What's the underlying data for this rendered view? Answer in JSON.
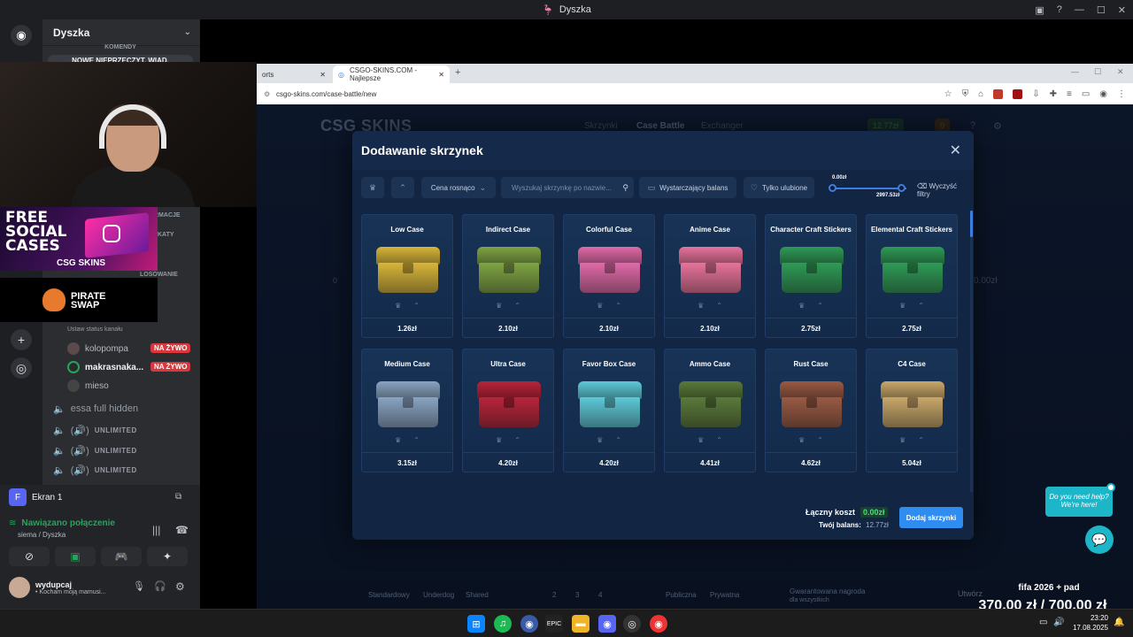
{
  "discord": {
    "window_title": "Dyszka",
    "server_name": "Dyszka",
    "notice_top": "KOMENDY",
    "notice": "NOWE NIEPRZECZYT. WIAD.",
    "side_labels": [
      "RMACJE",
      "KATY"
    ],
    "losowanie": "LOSOWANIE",
    "status_hint": "Ustaw status kanału",
    "voice_users": [
      {
        "name": "kolopompa",
        "live": "NA ŻYWO"
      },
      {
        "name": "makrasnaka...",
        "live": "NA ŻYWO"
      },
      {
        "name": "mieso",
        "live": ""
      }
    ],
    "channels": [
      {
        "name": "essa full hidden",
        "tag": ""
      },
      {
        "name": "",
        "tag": "UNLIMITED"
      },
      {
        "name": "",
        "tag": "UNLIMITED"
      },
      {
        "name": "",
        "tag": "UNLIMITED"
      }
    ],
    "screen_label": "Ekran 1",
    "connection_status": "Nawiązano połączenie",
    "connection_channel": "siema / Dyszka",
    "user_name": "wydupcaj",
    "user_status": "• Kocham moją mamusi..."
  },
  "promos": {
    "social_text": "FREE SOCIAL CASES",
    "social_brand": "CSG SKINS",
    "pirate_text": "PIRATE SWAP"
  },
  "browser": {
    "tab_prev": "orts",
    "tab_active": "CSGO-SKINS.COM - Najlepsze",
    "url": "csgo-skins.com/case-battle/new"
  },
  "site": {
    "logo": "CSG SKINS",
    "nav": [
      "Skrzynki",
      "Case Battle",
      "Exchanger"
    ],
    "balance": "12.77zł",
    "coins": "0",
    "bg_zero": "0",
    "bg_value": "0.00zł",
    "bg_bottom": [
      "Standardowy",
      "Underdog",
      "Shared",
      "2",
      "3",
      "4",
      "Publiczna",
      "Prywatna",
      "Gwarantowana nagroda",
      "dla wszystkich",
      "Utwórz"
    ]
  },
  "modal": {
    "title": "Dodawanie skrzynek",
    "sort": "Cena rosnąco",
    "search_placeholder": "Wyszukaj skrzynkę po nazwie...",
    "filter_balance": "Wystarczający balans",
    "filter_fav": "Tylko ulubione",
    "range_min": "0.00zł",
    "range_max": "2997.53zł",
    "clear": "Wyczyść filtry",
    "total_label": "Łączny koszt",
    "total_value": "0.00zł",
    "balance_label": "Twój balans:",
    "balance_value": "12.77zł",
    "add_button": "Dodaj skrzynki",
    "cases": [
      {
        "name": "Low Case",
        "price": "1.26zł",
        "color": "#d8b53a"
      },
      {
        "name": "Indirect Case",
        "price": "2.10zł",
        "color": "#7fa444"
      },
      {
        "name": "Colorful Case",
        "price": "2.10zł",
        "color": "#e06aa8"
      },
      {
        "name": "Anime Case",
        "price": "2.10zł",
        "color": "#e8739a"
      },
      {
        "name": "Character Craft Stickers",
        "price": "2.75zł",
        "color": "#2f9a56"
      },
      {
        "name": "Elemental Craft Stickers",
        "price": "2.75zł",
        "color": "#2f9a56"
      },
      {
        "name": "Medium Case",
        "price": "3.15zł",
        "color": "#8aa4c2"
      },
      {
        "name": "Ultra Case",
        "price": "4.20zł",
        "color": "#b8243a"
      },
      {
        "name": "Favor Box Case",
        "price": "4.20zł",
        "color": "#5ec9d8"
      },
      {
        "name": "Ammo Case",
        "price": "4.41zł",
        "color": "#5a7a3a"
      },
      {
        "name": "Rust Case",
        "price": "4.62zł",
        "color": "#9a5a44"
      },
      {
        "name": "C4 Case",
        "price": "5.04zł",
        "color": "#c9a76a"
      }
    ]
  },
  "chat": {
    "bubble": "Do you need help? We're here!"
  },
  "overlay": {
    "goal_title": "fifa 2026 + pad",
    "goal_value": "370,00 zł / 700,00 zł"
  },
  "clock": {
    "time": "23:20",
    "date": "17.08.2025"
  }
}
